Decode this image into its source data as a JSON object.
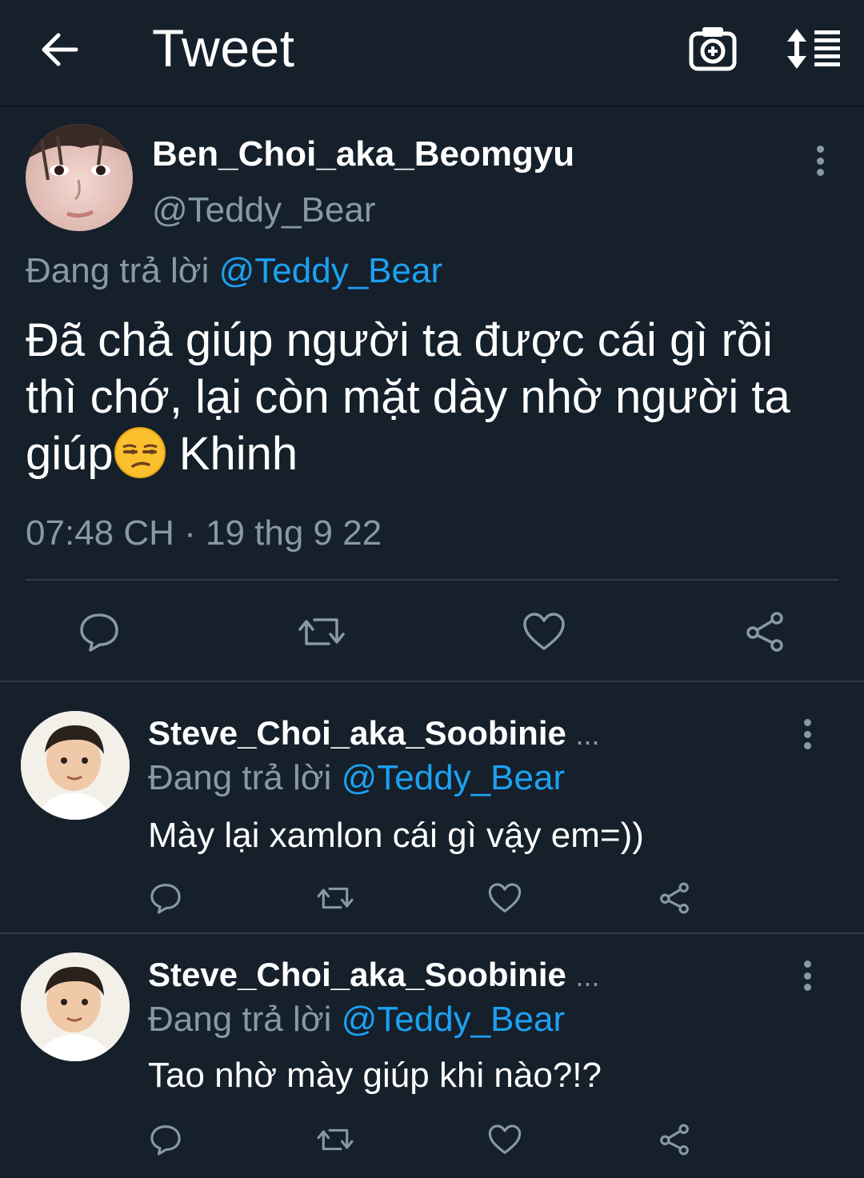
{
  "header": {
    "title": "Tweet",
    "back_icon": "arrow-left-icon",
    "camera_icon": "camera-add-icon",
    "sort_icon": "sort-list-icon"
  },
  "main_tweet": {
    "display_name": "Ben_Choi_aka_Beomgyu",
    "handle": "@Teddy_Bear",
    "replying_label": "Đang trả lời",
    "replying_to": "@Teddy_Bear",
    "text_part1": "Đã chả giúp người ta được cái gì rồi thì chớ, lại còn mặt dày nhờ người ta giúp",
    "text_part2": " Khinh",
    "emoji": "unamused-face",
    "timestamp": "07:48 CH · 19 thg 9 22",
    "actions": [
      "reply-icon",
      "retweet-icon",
      "like-icon",
      "share-icon"
    ]
  },
  "replies": [
    {
      "display_name": "Steve_Choi_aka_Soobinie",
      "ellipsis": "...",
      "replying_label": "Đang trả lời",
      "replying_to": "@Teddy_Bear",
      "text": "Mày lại xamlon cái gì vậy em=))"
    },
    {
      "display_name": "Steve_Choi_aka_Soobinie",
      "ellipsis": "...",
      "replying_label": "Đang trả lời",
      "replying_to": "@Teddy_Bear",
      "text": "Tao nhờ mày giúp khi nào?!?"
    }
  ],
  "colors": {
    "background": "#15202b",
    "secondary_text": "#8899a6",
    "accent": "#1da1f2",
    "divider": "#2f3b47"
  }
}
